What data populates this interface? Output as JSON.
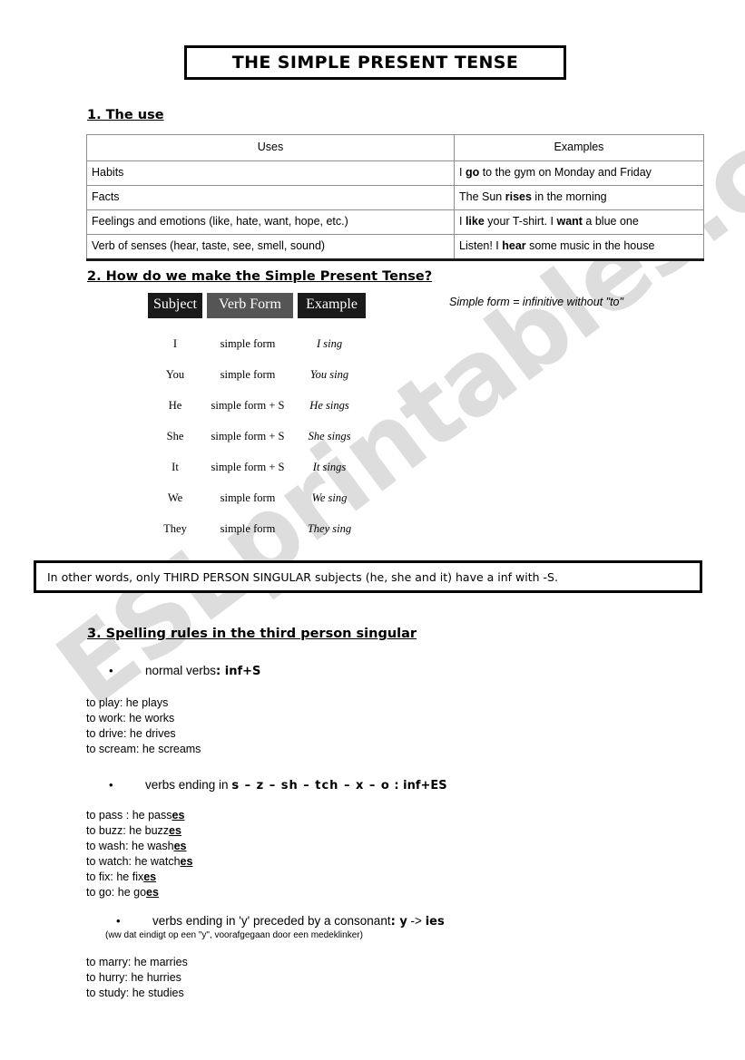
{
  "document": {
    "title": "THE SIMPLE PRESENT TENSE",
    "watermark": "ESLprintables.com"
  },
  "sections": {
    "use": {
      "heading": "1. The use",
      "table": {
        "headers": [
          "Uses",
          "Examples"
        ],
        "rows": [
          {
            "use": "Habits",
            "example_pre": "I ",
            "example_bold": "go",
            "example_post": " to the gym on Monday and Friday"
          },
          {
            "use": "Facts",
            "example_pre": "The Sun ",
            "example_bold": "rises",
            "example_post": " in the morning"
          },
          {
            "use": "Feelings and emotions (like, hate, want, hope, etc.)",
            "example_pre": "I ",
            "example_bold": "like",
            "example_mid": " your T-shirt. I ",
            "example_bold2": "want",
            "example_post": " a blue one"
          },
          {
            "use": "Verb of senses (hear, taste, see, smell, sound)",
            "example_pre": "Listen! I ",
            "example_bold": "hear",
            "example_post": " some music in the house"
          }
        ]
      }
    },
    "formation": {
      "heading": "2. How do we make the Simple Present Tense?",
      "note": "Simple form = infinitive without \"to\"",
      "headers": [
        "Subject",
        "Verb Form",
        "Example"
      ],
      "header_colors": {
        "subject": "#1a1a1a",
        "verb_form": "#555555",
        "example": "#1a1a1a"
      },
      "rows": [
        {
          "subject": "I",
          "verb": "simple form",
          "example": "I sing"
        },
        {
          "subject": "You",
          "verb": "simple form",
          "example": "You sing"
        },
        {
          "subject": "He",
          "verb": "simple form + S",
          "example": "He sings"
        },
        {
          "subject": "She",
          "verb": "simple form + S",
          "example": "She sings"
        },
        {
          "subject": "It",
          "verb": "simple form + S",
          "example": "It sings"
        },
        {
          "subject": "We",
          "verb": "simple form",
          "example": "We sing"
        },
        {
          "subject": "They",
          "verb": "simple form",
          "example": "They sing"
        }
      ],
      "statement": "In other words, only THIRD PERSON SINGULAR subjects (he, she and it) have a inf with -S."
    },
    "spelling": {
      "heading": "3. Spelling rules in the third person singular",
      "rules": [
        {
          "bullet_text": "normal verbs",
          "separator": ": ",
          "formula": "inf+S",
          "examples": [
            "to play: he plays",
            "to work: he works",
            "to drive: he drives",
            "to scream: he screams"
          ]
        },
        {
          "bullet_text": "verbs ending in ",
          "letters": "s – z – sh – tch – x – o",
          "separator": "  : ",
          "formula": "inf+ES",
          "examples_split": [
            {
              "stem": "to pass : he pass",
              "ending": "es"
            },
            {
              "stem": "to buzz: he buzz",
              "ending": "es"
            },
            {
              "stem": "to wash: he wash",
              "ending": "es"
            },
            {
              "stem": "to watch: he watch",
              "ending": "es"
            },
            {
              "stem": "to fix: he fix",
              "ending": "es"
            },
            {
              "stem": "to go: he go",
              "ending": "es"
            }
          ]
        },
        {
          "bullet_text": "verbs ending in 'y' preceded by a consonant",
          "separator": ": ",
          "formula_y": "y",
          "formula_arrow": " -> ",
          "formula_ies": "ies",
          "subnote": "(ww dat eindigt op een \"y\", voorafgegaan door een medeklinker)",
          "examples": [
            "to marry: he marries",
            "to hurry: he hurries",
            "to study: he studies"
          ]
        }
      ]
    }
  }
}
